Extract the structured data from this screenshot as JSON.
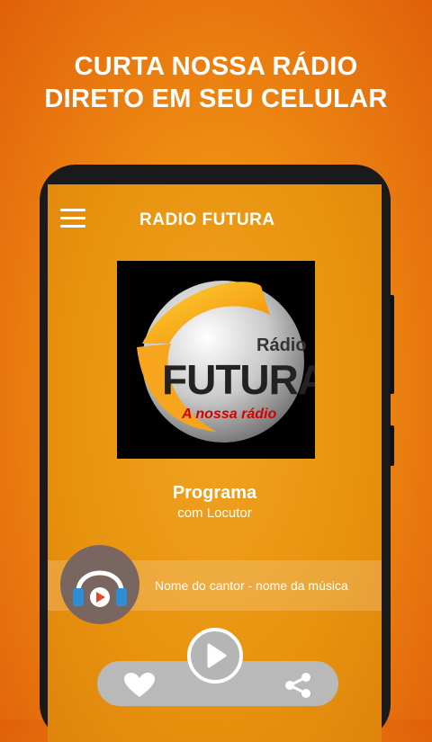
{
  "promo": {
    "line1": "CURTA NOSSA RÁDIO",
    "line2": "DIRETO EM SEU CELULAR"
  },
  "app": {
    "title": "RADIO FUTURA",
    "menu_icon": "hamburger-menu-icon"
  },
  "logo": {
    "top_text": "Rádio",
    "main_text": "FUTURA",
    "tagline": "A nossa rádio"
  },
  "program": {
    "name": "Programa",
    "host": "com Locutor"
  },
  "now_playing": {
    "text": "Nome do cantor - nome da música",
    "icon": "headphones-play-icon"
  },
  "controls": {
    "like_icon": "heart-icon",
    "play_icon": "play-icon",
    "share_icon": "share-icon"
  },
  "colors": {
    "background_orange": "#ee8a12",
    "screen_orange": "#e8930e",
    "accent_red": "#e8442a",
    "headphone_blue": "#2e8fd6"
  }
}
